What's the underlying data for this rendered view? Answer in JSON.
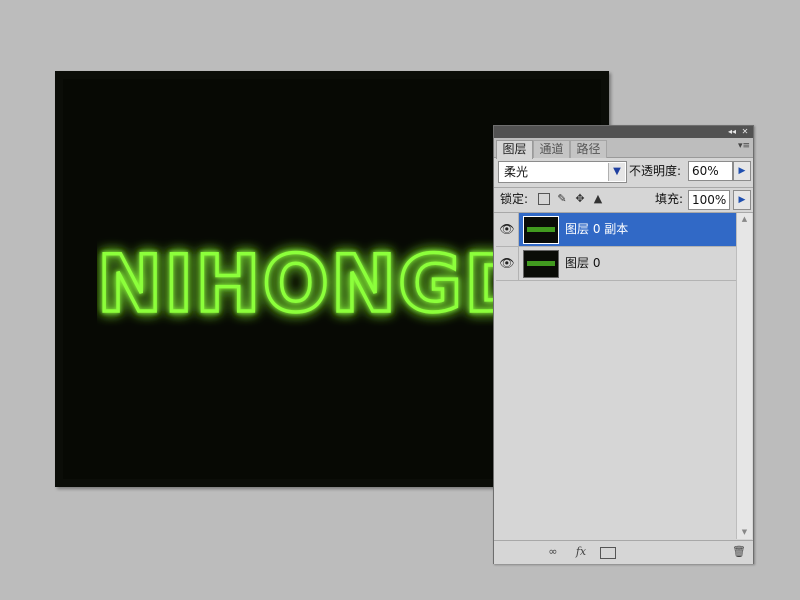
{
  "canvas": {
    "neon_text": "NIHONGDE",
    "neon_color": "#7cff2e"
  },
  "panel": {
    "titlebar": {
      "collapse_icon": "double-chevron-left-icon",
      "close_icon": "close-icon"
    },
    "tabs": [
      {
        "label": "图层"
      },
      {
        "label": "通道"
      },
      {
        "label": "路径"
      }
    ],
    "menu_icon": "panel-menu-icon",
    "blend_mode": "柔光",
    "opacity_label": "不透明度:",
    "opacity_value": "60%",
    "lock_label": "锁定:",
    "fill_label": "填充:",
    "fill_value": "100%",
    "layers": [
      {
        "name": "图层 0 副本",
        "selected": true
      },
      {
        "name": "图层 0",
        "selected": false
      }
    ],
    "footer_icons": [
      "link-icon",
      "fx-icon",
      "mask-icon",
      "trash-icon"
    ],
    "colors": {
      "selection": "#3169c6",
      "panel_bg": "#d6d6d6"
    }
  }
}
